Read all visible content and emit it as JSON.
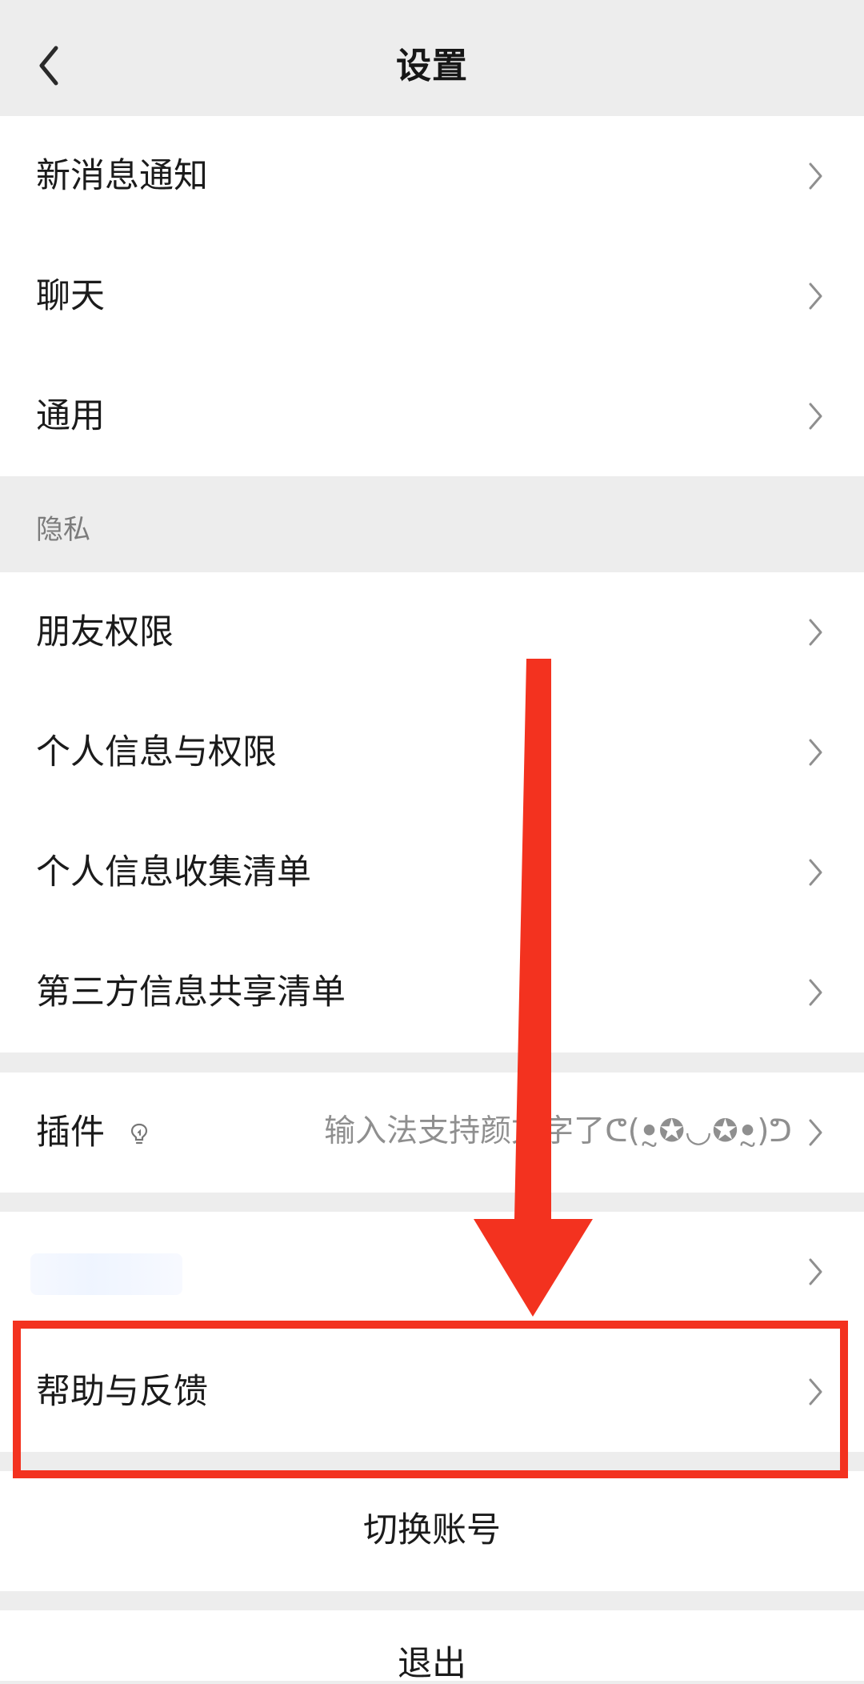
{
  "header": {
    "title": "设置"
  },
  "sections": {
    "top": {
      "items": [
        {
          "label": "新消息通知"
        },
        {
          "label": "聊天"
        },
        {
          "label": "通用"
        }
      ]
    },
    "privacy": {
      "header": "隐私",
      "items": [
        {
          "label": "朋友权限"
        },
        {
          "label": "个人信息与权限"
        },
        {
          "label": "个人信息收集清单"
        },
        {
          "label": "第三方信息共享清单"
        }
      ]
    },
    "plugins": {
      "label": "插件",
      "value": "输入法支持颜文字了ᕦ(ꔸ✪◡✪ꔸ)ᕤ"
    },
    "support": {
      "items": [
        {
          "label": "帮助与反馈"
        }
      ]
    },
    "actions": {
      "switch_account": "切换账号",
      "logout": "退出"
    }
  },
  "annotation": {
    "highlight_color": "#f3321f"
  },
  "icons": {
    "back": "back-icon",
    "chevron": "chevron-right-icon",
    "plugin": "lightbulb-icon"
  }
}
